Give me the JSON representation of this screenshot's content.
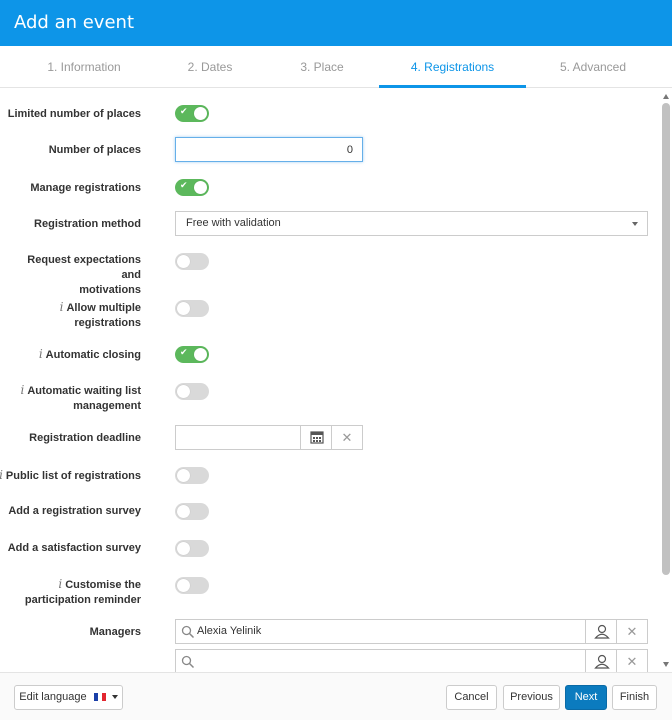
{
  "header": {
    "title": "Add an event"
  },
  "tabs": [
    {
      "label": "1. Information"
    },
    {
      "label": "2. Dates"
    },
    {
      "label": "3. Place"
    },
    {
      "label": "4. Registrations"
    },
    {
      "label": "5. Advanced"
    }
  ],
  "active_tab": "4. Registrations",
  "form": {
    "limited_places": {
      "label": "Limited number of places",
      "on": true
    },
    "number_of_places": {
      "label": "Number of places",
      "value": "0"
    },
    "manage_registrations": {
      "label": "Manage registrations",
      "on": true
    },
    "registration_method": {
      "label": "Registration method",
      "value": "Free with validation"
    },
    "request_expectations": {
      "label_line1": "Request expectations and",
      "label_line2": "motivations",
      "on": false
    },
    "allow_multiple": {
      "label_line1": "Allow multiple",
      "label_line2": "registrations",
      "on": false
    },
    "automatic_closing": {
      "label": "Automatic closing",
      "on": true
    },
    "waiting_list": {
      "label_line1": "Automatic waiting list",
      "label_line2": "management",
      "on": false
    },
    "registration_deadline": {
      "label": "Registration deadline",
      "value": ""
    },
    "public_list": {
      "label": "Public list of registrations",
      "on": false
    },
    "registration_survey": {
      "label": "Add a registration survey",
      "on": false
    },
    "satisfaction_survey": {
      "label": "Add a satisfaction survey",
      "on": false
    },
    "participation_reminder": {
      "label_line1": "Customise the",
      "label_line2": "participation reminder",
      "on": false
    },
    "managers": {
      "label": "Managers",
      "values": [
        "Alexia Yelinik",
        ""
      ]
    }
  },
  "footer": {
    "edit_language": "Edit language",
    "cancel": "Cancel",
    "previous": "Previous",
    "next": "Next",
    "finish": "Finish"
  },
  "colors": {
    "brand": "#0d95e8",
    "toggle_on": "#5cb85c",
    "primary_button": "#0b7bbf"
  },
  "icons": [
    "info-icon",
    "check-icon",
    "calendar-icon",
    "close-icon",
    "search-icon",
    "user-icon",
    "chevron-down-icon",
    "flag-fr-icon"
  ]
}
